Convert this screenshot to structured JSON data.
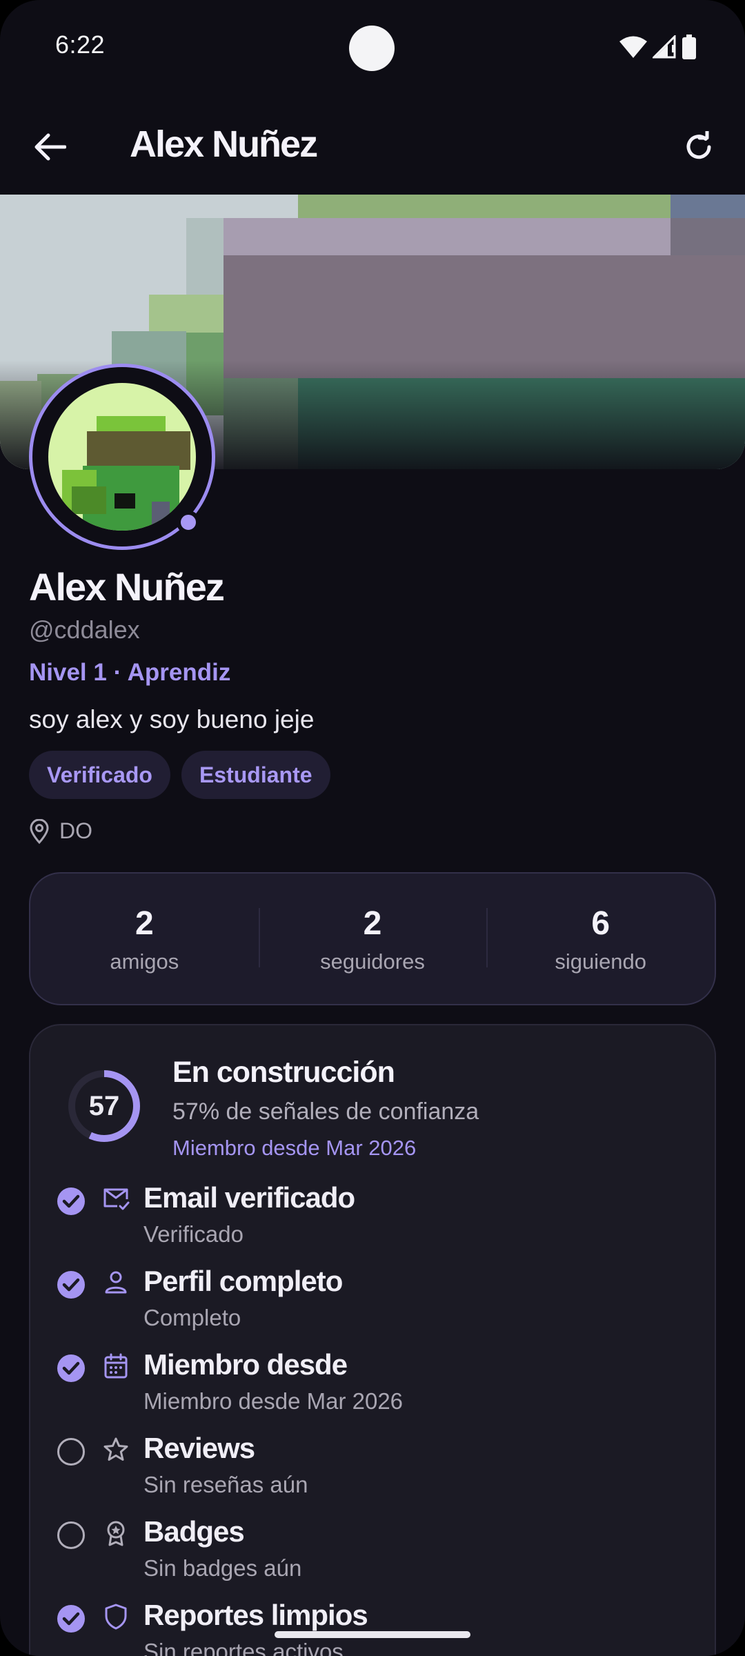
{
  "status_bar": {
    "time": "6:22",
    "icons": [
      "wifi-icon",
      "signal-icon",
      "battery-icon"
    ]
  },
  "app_bar": {
    "title": "Alex Nuñez",
    "back_icon": "arrow-left-icon",
    "refresh_icon": "refresh-icon"
  },
  "profile": {
    "name": "Alex Nuñez",
    "handle": "@cddalex",
    "level": "Nivel 1 · Aprendiz",
    "bio": "soy alex y soy bueno jeje",
    "tags": [
      "Verificado",
      "Estudiante"
    ],
    "location": "DO"
  },
  "stats": [
    {
      "value": "2",
      "label": "amigos"
    },
    {
      "value": "2",
      "label": "seguidores"
    },
    {
      "value": "6",
      "label": "siguiendo"
    }
  ],
  "trust": {
    "score": 57,
    "score_text": "57",
    "title": "En construcción",
    "subtitle": "57% de señales de confianza",
    "member_since": "Miembro desde Mar 2026",
    "signals": [
      {
        "icon": "mail-check-icon",
        "title": "Email verificado",
        "status": "Verificado",
        "done": true
      },
      {
        "icon": "person-icon",
        "title": "Perfil completo",
        "status": "Completo",
        "done": true
      },
      {
        "icon": "calendar-icon",
        "title": "Miembro desde",
        "status": "Miembro desde Mar 2026",
        "done": true
      },
      {
        "icon": "star-icon",
        "title": "Reviews",
        "status": "Sin reseñas aún",
        "done": false
      },
      {
        "icon": "badge-icon",
        "title": "Badges",
        "status": "Sin badges aún",
        "done": false
      },
      {
        "icon": "shield-icon",
        "title": "Reportes limpios",
        "status": "Sin reportes activos",
        "done": true
      }
    ]
  },
  "colors": {
    "background": "#0e0d15",
    "accent": "#a595f2",
    "card": "#1d1b2b"
  }
}
